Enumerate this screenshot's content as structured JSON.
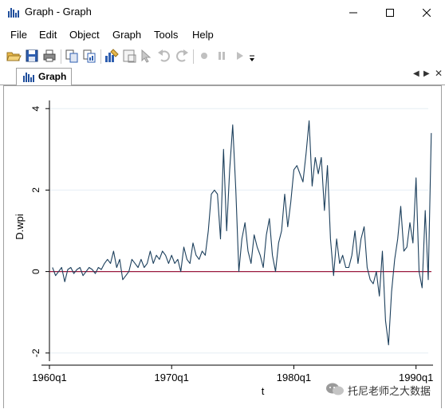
{
  "window": {
    "title": "Graph - Graph"
  },
  "menu": [
    "File",
    "Edit",
    "Object",
    "Graph",
    "Tools",
    "Help"
  ],
  "tab": {
    "label": "Graph"
  },
  "colors": {
    "series": "#1c3f5c",
    "zero_line": "#9b1b3e",
    "grid": "#e6eef4",
    "toolbar_icon": "#4a6fa5"
  },
  "chart_data": {
    "type": "line",
    "xlabel": "t",
    "ylabel": "D.wpi",
    "xlim": [
      1960,
      1991
    ],
    "ylim": [
      -2.2,
      4.2
    ],
    "x_ticks": [
      1960,
      1970,
      1980,
      1990
    ],
    "x_tick_labels": [
      "1960q1",
      "1970q1",
      "1980q1",
      "1990q1"
    ],
    "y_ticks": [
      -2,
      0,
      2,
      4
    ],
    "y_tick_labels": [
      "-2",
      "0",
      "2",
      "4"
    ],
    "reference_line": {
      "y": 0
    },
    "grid": true,
    "series": [
      {
        "x_start": 1960.25,
        "x_step": 0.25,
        "values": [
          0.1,
          -0.1,
          0.0,
          0.1,
          -0.25,
          0.05,
          0.1,
          -0.05,
          0.05,
          0.1,
          -0.1,
          0.0,
          0.1,
          0.05,
          -0.05,
          0.1,
          0.05,
          0.2,
          0.3,
          0.2,
          0.5,
          0.1,
          0.3,
          -0.2,
          -0.1,
          0.0,
          0.3,
          0.2,
          0.1,
          0.3,
          0.1,
          0.2,
          0.5,
          0.2,
          0.4,
          0.3,
          0.5,
          0.4,
          0.2,
          0.4,
          0.2,
          0.3,
          0.0,
          0.6,
          0.3,
          0.2,
          0.7,
          0.4,
          0.3,
          0.5,
          0.4,
          1.0,
          1.9,
          2.0,
          1.9,
          0.8,
          3.0,
          1.0,
          2.5,
          3.6,
          2.0,
          0.0,
          0.8,
          1.2,
          0.5,
          0.2,
          0.9,
          0.6,
          0.4,
          0.1,
          0.9,
          1.3,
          0.4,
          0.0,
          0.7,
          1.0,
          1.9,
          1.1,
          1.7,
          2.5,
          2.6,
          2.4,
          2.2,
          2.9,
          3.7,
          2.1,
          2.8,
          2.4,
          2.8,
          1.5,
          2.6,
          0.8,
          -0.1,
          0.8,
          0.2,
          0.4,
          0.1,
          0.1,
          0.4,
          1.0,
          0.2,
          0.8,
          1.1,
          0.1,
          -0.2,
          -0.3,
          0.0,
          -0.6,
          0.5,
          -1.2,
          -1.8,
          -0.5,
          0.3,
          0.8,
          1.6,
          0.5,
          0.6,
          1.2,
          0.7,
          2.3,
          0.0,
          -0.4,
          1.5,
          -0.2,
          3.4
        ]
      }
    ]
  },
  "watermark": {
    "text": "托尼老师之大数据"
  }
}
